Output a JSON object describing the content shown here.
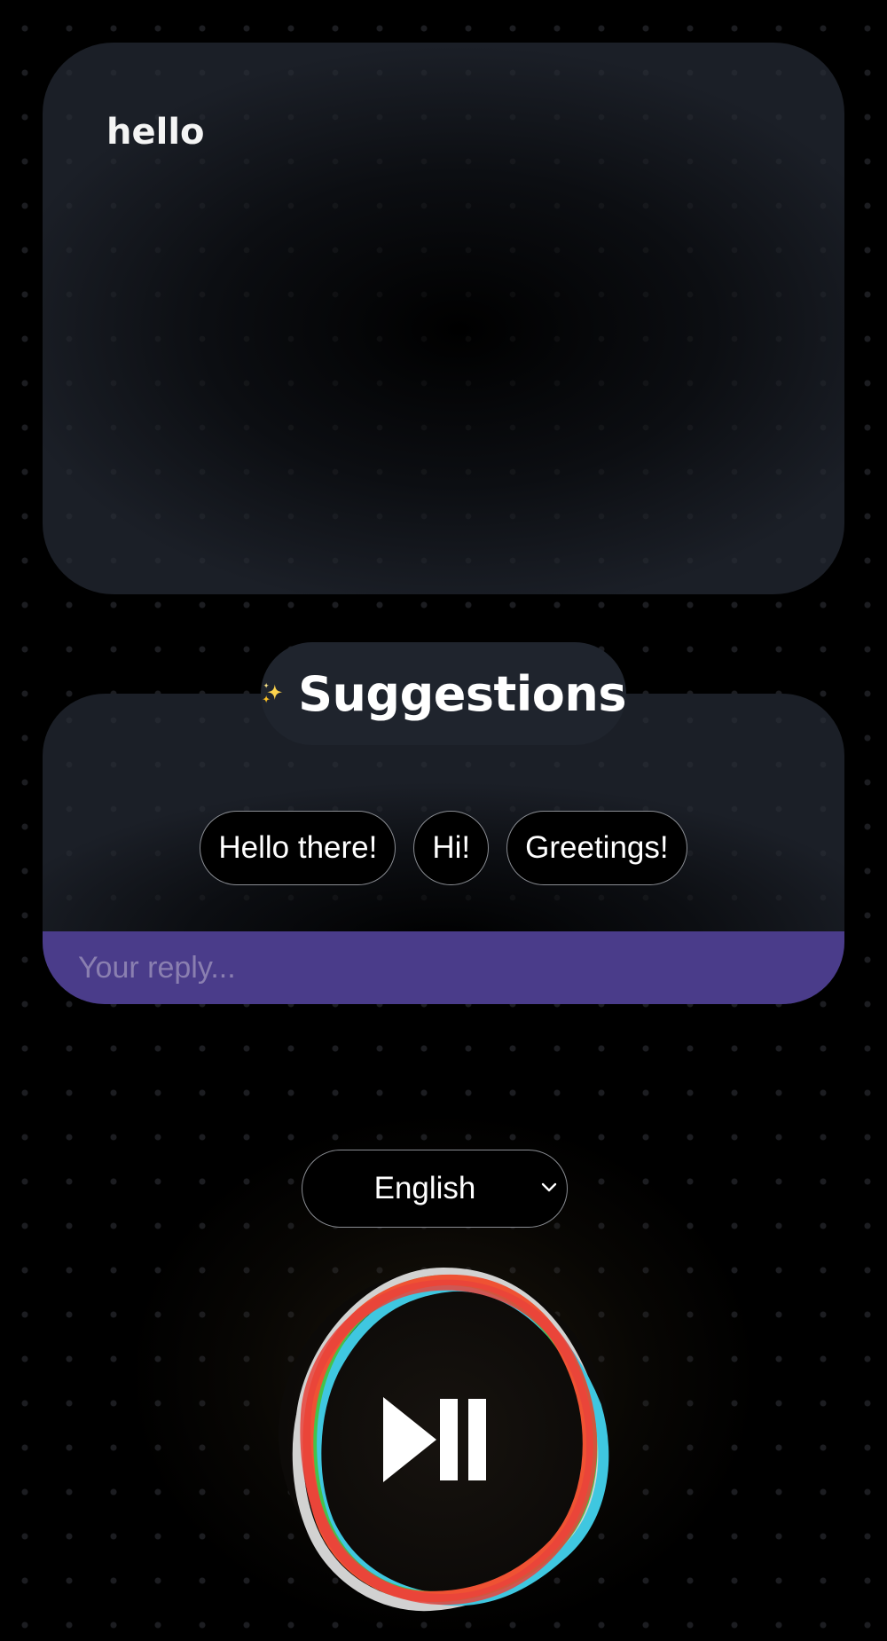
{
  "transcript": {
    "text": "hello"
  },
  "suggestions": {
    "header_icon": "sparkles-icon",
    "title": "Suggestions",
    "items": [
      {
        "label": "Hello there!"
      },
      {
        "label": "Hi!"
      },
      {
        "label": "Greetings!"
      }
    ]
  },
  "reply": {
    "placeholder": "Your reply...",
    "value": ""
  },
  "language": {
    "selected": "English"
  },
  "player": {
    "icon": "play-pause-icon",
    "ring_colors": [
      "#e8e8e8",
      "#3fc7e0",
      "#45c24a",
      "#ef5233",
      "#e9433b"
    ]
  },
  "theme": {
    "background": "#000000",
    "card": "#1b1f27",
    "reply_bar": "#4a3c8a",
    "text": "#ffffff"
  }
}
